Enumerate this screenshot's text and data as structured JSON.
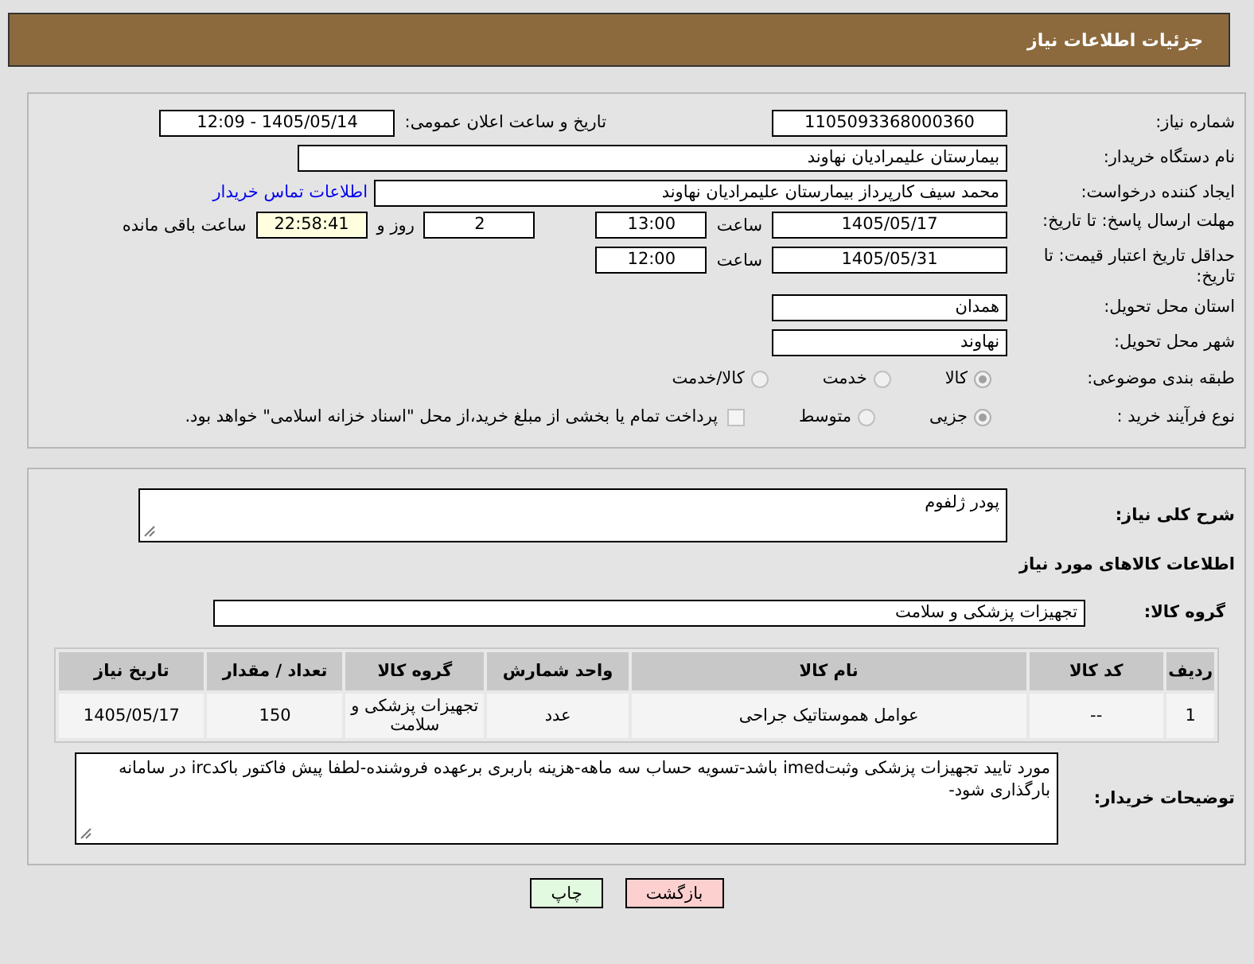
{
  "header": {
    "title": "جزئیات اطلاعات نیاز"
  },
  "need_number": {
    "label": "شماره نیاز:",
    "value": "1105093368000360"
  },
  "announce": {
    "label": "تاریخ و ساعت اعلان عمومی:",
    "value": "1405/05/14 - 12:09"
  },
  "buyer_org": {
    "label": "نام دستگاه خریدار:",
    "value": "بیمارستان علیمرادیان نهاوند"
  },
  "requester": {
    "label": "ایجاد کننده درخواست:",
    "value": "محمد سیف کارپرداز بیمارستان علیمرادیان نهاوند",
    "link": "اطلاعات تماس خریدار"
  },
  "reply_deadline": {
    "label": "مهلت ارسال پاسخ: تا تاریخ:",
    "date": "1405/05/17",
    "time_label": "ساعت",
    "time": "13:00",
    "days": "2",
    "days_label": "روز و",
    "remaining": "22:58:41",
    "remaining_label": "ساعت باقی مانده"
  },
  "validity": {
    "label": "حداقل تاریخ اعتبار قیمت: تا تاریخ:",
    "date": "1405/05/31",
    "time_label": "ساعت",
    "time": "12:00"
  },
  "province": {
    "label": "استان محل تحویل:",
    "value": "همدان"
  },
  "city": {
    "label": "شهر محل تحویل:",
    "value": "نهاوند"
  },
  "category": {
    "label": "طبقه بندی موضوعی:",
    "options": [
      {
        "label": "کالا",
        "selected": true
      },
      {
        "label": "خدمت",
        "selected": false
      },
      {
        "label": "کالا/خدمت",
        "selected": false
      }
    ]
  },
  "process": {
    "label": "نوع فرآیند خرید :",
    "options": [
      {
        "label": "جزیی",
        "selected": true
      },
      {
        "label": "متوسط",
        "selected": false
      }
    ],
    "treasury": {
      "checked": false,
      "label": "پرداخت تمام یا بخشی از مبلغ خرید،از محل \"اسناد خزانه اسلامی\" خواهد بود."
    }
  },
  "description": {
    "label": "شرح کلی نیاز:",
    "value": "پودر ژلفوم"
  },
  "items_title": "اطلاعات کالاهای مورد نیاز",
  "group": {
    "label": "گروه کالا:",
    "value": "تجهیزات پزشکی و سلامت"
  },
  "table": {
    "columns": [
      "ردیف",
      "کد کالا",
      "نام کالا",
      "واحد شمارش",
      "گروه کالا",
      "تعداد / مقدار",
      "تاریخ نیاز"
    ],
    "rows": [
      [
        "1",
        "--",
        "عوامل هموستاتیک جراحی",
        "عدد",
        "تجهیزات پزشکی و سلامت",
        "150",
        "1405/05/17"
      ]
    ]
  },
  "buyer_notes": {
    "label": "توضیحات خریدار:",
    "value": "مورد تایید تجهیزات پزشکی وثبتimed باشد-تسویه حساب سه ماهه-هزینه باربری برعهده فروشنده-لطفا پیش فاکتور باکدirc در سامانه بارگذاری شود-"
  },
  "buttons": [
    {
      "label": "بازگشت",
      "kind": "back"
    },
    {
      "label": "چاپ",
      "kind": "print"
    }
  ]
}
